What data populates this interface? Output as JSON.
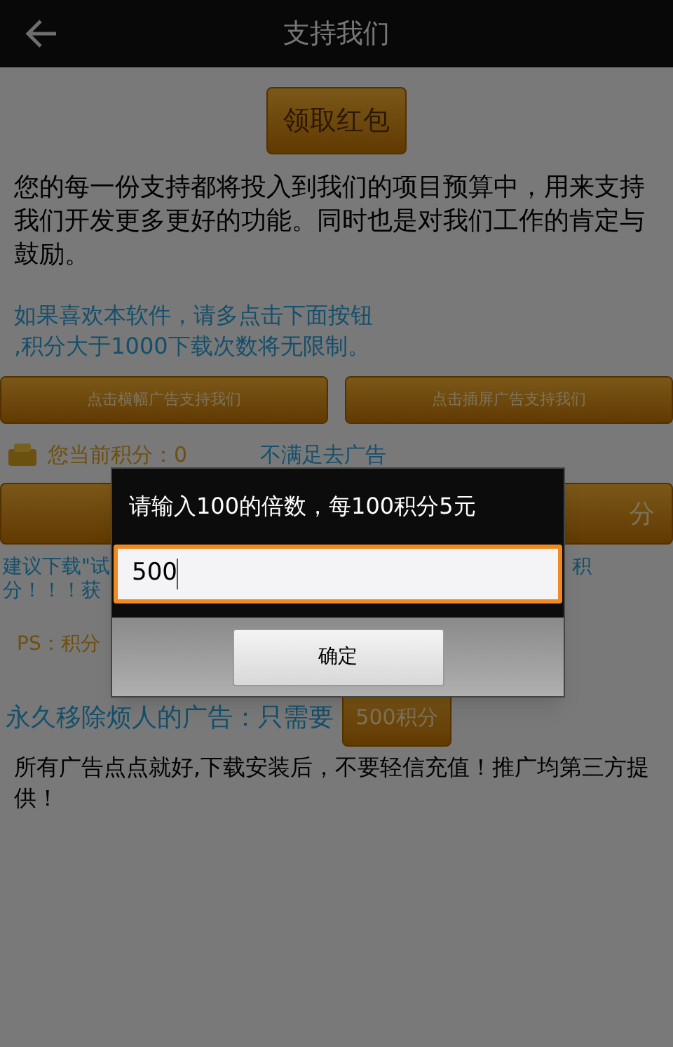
{
  "title_bar": {
    "title": "支持我们"
  },
  "claim_button": "领取红包",
  "intro": "您的每一份支持都将投入到我们的项目预算中，用来支持我们开发更多更好的功能。同时也是对我们工作的肯定与鼓励。",
  "hint_lines": [
    "如果喜欢本软件，请多点击下面按钮",
    ",积分大于1000下载次数将无限制。"
  ],
  "ad_buttons": [
    "点击横幅广告支持我们",
    "点击插屏广告支持我们"
  ],
  "points_label": "您当前积分：0",
  "remove_ads_link": "不满足去广告",
  "wide_button_text": "分",
  "suggestion_lines": [
    {
      "left": "建议下载\"试",
      "right": "积"
    },
    {
      "left": "分！！！获"
    }
  ],
  "ps": "PS：积分",
  "remove_ads": {
    "text": "永久移除烦人的广告：只需要",
    "button": "500积分"
  },
  "notice": "所有广告点点就好,下载安装后，不要轻信充值！推广均第三方提供！",
  "dialog": {
    "title": "请输入100的倍数，每100积分5元",
    "value": "500",
    "focused": true,
    "button": "确定"
  }
}
